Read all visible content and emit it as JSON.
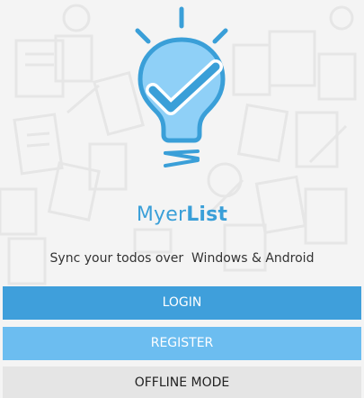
{
  "app": {
    "title_light": "Myer",
    "title_bold": "List",
    "tagline": "Sync your todos over  Windows & Android"
  },
  "buttons": {
    "login_label": "LOGIN",
    "register_label": "REGISTER",
    "offline_label": "OFFLINE MODE"
  },
  "colors": {
    "accent": "#3a9fd8",
    "login_bg": "#3f9fdb",
    "register_bg": "#6cbdf0",
    "offline_bg": "#e5e5e5",
    "bulb_fill": "#8fd0f7",
    "background": "#f4f4f4"
  },
  "icons": {
    "logo": "lightbulb-check-icon"
  }
}
